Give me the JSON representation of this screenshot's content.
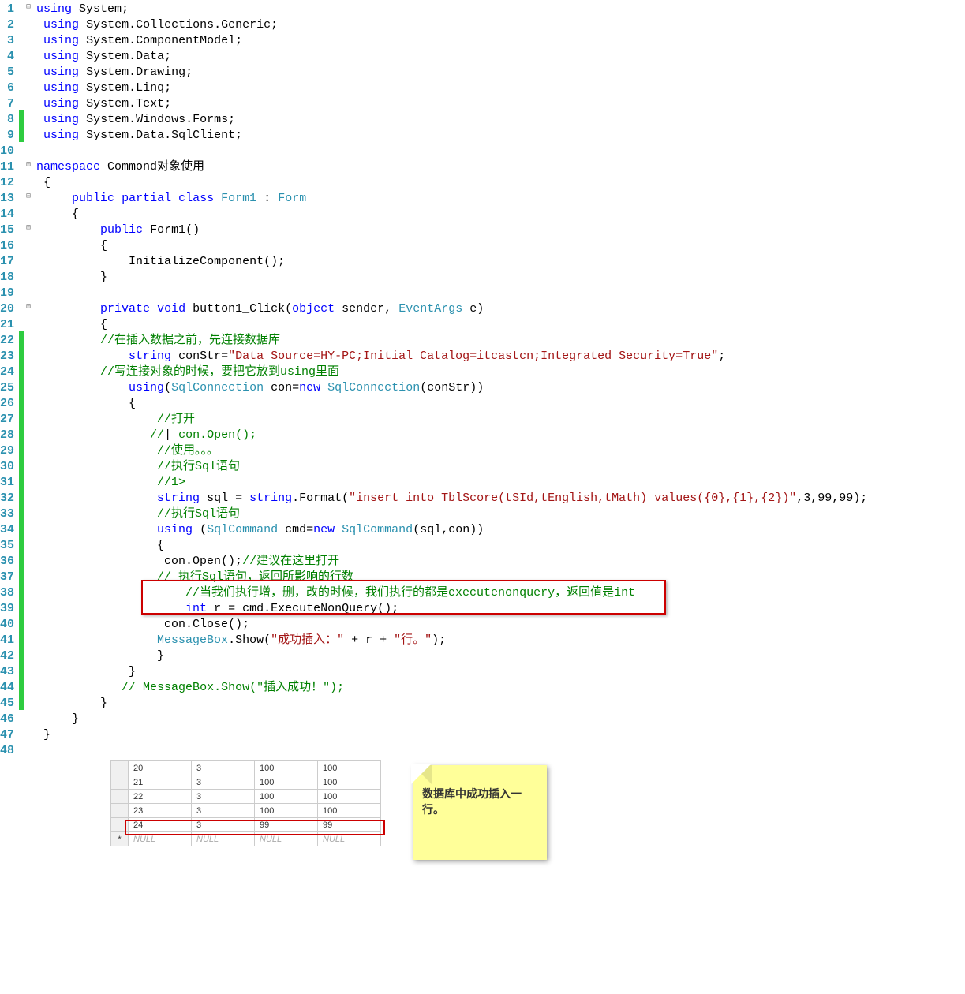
{
  "code": {
    "lines": [
      {
        "n": 1,
        "marker": "",
        "fold": "⊟",
        "html": "<span class='kw'>using</span> <span class='txt'>System;</span>"
      },
      {
        "n": 2,
        "marker": "",
        "fold": "",
        "html": " <span class='kw'>using</span> <span class='txt'>System.Collections.Generic;</span>"
      },
      {
        "n": 3,
        "marker": "",
        "fold": "",
        "html": " <span class='kw'>using</span> <span class='txt'>System.ComponentModel;</span>"
      },
      {
        "n": 4,
        "marker": "",
        "fold": "",
        "html": " <span class='kw'>using</span> <span class='txt'>System.Data;</span>"
      },
      {
        "n": 5,
        "marker": "",
        "fold": "",
        "html": " <span class='kw'>using</span> <span class='txt'>System.Drawing;</span>"
      },
      {
        "n": 6,
        "marker": "",
        "fold": "",
        "html": " <span class='kw'>using</span> <span class='txt'>System.Linq;</span>"
      },
      {
        "n": 7,
        "marker": "",
        "fold": "",
        "html": " <span class='kw'>using</span> <span class='txt'>System.Text;</span>"
      },
      {
        "n": 8,
        "marker": "green",
        "fold": "",
        "html": " <span class='kw'>using</span> <span class='txt'>System.Windows.Forms;</span>"
      },
      {
        "n": 9,
        "marker": "green",
        "fold": "",
        "html": " <span class='kw'>using</span> <span class='txt'>System.Data.SqlClient;</span>"
      },
      {
        "n": 10,
        "marker": "",
        "fold": "",
        "html": ""
      },
      {
        "n": 11,
        "marker": "",
        "fold": "⊟",
        "html": "<span class='kw'>namespace</span> <span class='txt'>Commond对象使用</span>"
      },
      {
        "n": 12,
        "marker": "",
        "fold": "",
        "html": " <span class='txt'>{</span>"
      },
      {
        "n": 13,
        "marker": "",
        "fold": "⊟",
        "html": "     <span class='kw'>public</span> <span class='kw'>partial</span> <span class='kw'>class</span> <span class='type'>Form1</span> <span class='txt'>:</span> <span class='type'>Form</span>"
      },
      {
        "n": 14,
        "marker": "",
        "fold": "",
        "html": "     <span class='txt'>{</span>"
      },
      {
        "n": 15,
        "marker": "",
        "fold": "⊟",
        "html": "         <span class='kw'>public</span> <span class='txt'>Form1()</span>"
      },
      {
        "n": 16,
        "marker": "",
        "fold": "",
        "html": "         <span class='txt'>{</span>"
      },
      {
        "n": 17,
        "marker": "",
        "fold": "",
        "html": "             <span class='txt'>InitializeComponent();</span>"
      },
      {
        "n": 18,
        "marker": "",
        "fold": "",
        "html": "         <span class='txt'>}</span>"
      },
      {
        "n": 19,
        "marker": "",
        "fold": "",
        "html": ""
      },
      {
        "n": 20,
        "marker": "",
        "fold": "⊟",
        "html": "         <span class='kw'>private</span> <span class='kw'>void</span> <span class='txt'>button1_Click(</span><span class='kw'>object</span> <span class='txt'>sender,</span> <span class='type'>EventArgs</span> <span class='txt'>e)</span>"
      },
      {
        "n": 21,
        "marker": "",
        "fold": "",
        "html": "         <span class='txt'>{</span>"
      },
      {
        "n": 22,
        "marker": "green",
        "fold": "",
        "html": "         <span class='comment'>//在插入数据之前，先连接数据库</span>"
      },
      {
        "n": 23,
        "marker": "green",
        "fold": "",
        "html": "             <span class='kw'>string</span> <span class='txt'>conStr=</span><span class='str'>\"Data Source=HY-PC;Initial Catalog=itcastcn;Integrated Security=True\"</span><span class='txt'>;</span>"
      },
      {
        "n": 24,
        "marker": "green",
        "fold": "",
        "html": "         <span class='comment'>//写连接对象的时候，要把它放到using里面</span>"
      },
      {
        "n": 25,
        "marker": "green",
        "fold": "",
        "html": "             <span class='kw'>using</span><span class='txt'>(</span><span class='type'>SqlConnection</span> <span class='txt'>con=</span><span class='kw'>new</span> <span class='type'>SqlConnection</span><span class='txt'>(conStr))</span>"
      },
      {
        "n": 26,
        "marker": "green",
        "fold": "",
        "html": "             <span class='txt'>{</span>"
      },
      {
        "n": 27,
        "marker": "green",
        "fold": "",
        "html": "                 <span class='comment'>//打开</span>"
      },
      {
        "n": 28,
        "marker": "green",
        "fold": "",
        "html": "                <span class='comment'>//</span><span class='txt'>|</span><span class='comment'> con.Open();</span>"
      },
      {
        "n": 29,
        "marker": "green",
        "fold": "",
        "html": "                 <span class='comment'>//使用。。。</span>"
      },
      {
        "n": 30,
        "marker": "green",
        "fold": "",
        "html": "                 <span class='comment'>//执行Sql语句</span>"
      },
      {
        "n": 31,
        "marker": "green",
        "fold": "",
        "html": "                 <span class='comment'>//1&gt;</span>"
      },
      {
        "n": 32,
        "marker": "green",
        "fold": "",
        "html": "                 <span class='kw'>string</span> <span class='txt'>sql = </span><span class='kw'>string</span><span class='txt'>.Format(</span><span class='str'>\"insert into TblScore(tSId,tEnglish,tMath) values({0},{1},{2})\"</span><span class='txt'>,3,99,99);</span>"
      },
      {
        "n": 33,
        "marker": "green",
        "fold": "",
        "html": "                 <span class='comment'>//执行Sql语句</span>"
      },
      {
        "n": 34,
        "marker": "green",
        "fold": "",
        "html": "                 <span class='kw'>using</span> <span class='txt'>(</span><span class='type'>SqlCommand</span> <span class='txt'>cmd=</span><span class='kw'>new</span> <span class='type'>SqlCommand</span><span class='txt'>(sql,con))</span>"
      },
      {
        "n": 35,
        "marker": "green",
        "fold": "",
        "html": "                 <span class='txt'>{</span>"
      },
      {
        "n": 36,
        "marker": "green",
        "fold": "",
        "html": "                  <span class='txt'>con.Open();</span><span class='comment'>//建议在这里打开</span>"
      },
      {
        "n": 37,
        "marker": "green",
        "fold": "",
        "html": "                 <span class='comment'>// 执行Sql语句，返回所影响的行数</span>"
      },
      {
        "n": 38,
        "marker": "green",
        "fold": "",
        "html": "                     <span class='comment'>//当我们执行增，删，改的时候，我们执行的都是executenonquery，返回值是int</span>"
      },
      {
        "n": 39,
        "marker": "green",
        "fold": "",
        "html": "                     <span class='kw'>int</span> <span class='txt'>r = cmd.ExecuteNonQuery();</span>"
      },
      {
        "n": 40,
        "marker": "green",
        "fold": "",
        "html": "                  <span class='txt'>con.Close();</span>"
      },
      {
        "n": 41,
        "marker": "green",
        "fold": "",
        "html": "                 <span class='type'>MessageBox</span><span class='txt'>.Show(</span><span class='str'>\"成功插入：\"</span> <span class='txt'>+ r +</span> <span class='str'>\"行。\"</span><span class='txt'>);</span>"
      },
      {
        "n": 42,
        "marker": "green",
        "fold": "",
        "html": "                 <span class='txt'>}</span>"
      },
      {
        "n": 43,
        "marker": "green",
        "fold": "",
        "html": "             <span class='txt'>}</span>"
      },
      {
        "n": 44,
        "marker": "green",
        "fold": "",
        "html": "            <span class='comment'>// MessageBox.Show(\"插入成功！\");</span>"
      },
      {
        "n": 45,
        "marker": "green",
        "fold": "",
        "html": "         <span class='txt'>}</span>"
      },
      {
        "n": 46,
        "marker": "",
        "fold": "",
        "html": "     <span class='txt'>}</span>"
      },
      {
        "n": 47,
        "marker": "",
        "fold": "",
        "html": " <span class='txt'>}</span>"
      },
      {
        "n": 48,
        "marker": "",
        "fold": "",
        "html": ""
      }
    ]
  },
  "db": {
    "rows": [
      [
        "",
        "20",
        "3",
        "100",
        "100"
      ],
      [
        "",
        "21",
        "3",
        "100",
        "100"
      ],
      [
        "",
        "22",
        "3",
        "100",
        "100"
      ],
      [
        "",
        "23",
        "3",
        "100",
        "100"
      ],
      [
        "",
        "24",
        "3",
        "99",
        "99"
      ],
      [
        "*",
        "NULL",
        "NULL",
        "NULL",
        "NULL"
      ]
    ],
    "highlight_row_index": 4
  },
  "sticky": {
    "text": "数据库中成功插入一行。"
  }
}
